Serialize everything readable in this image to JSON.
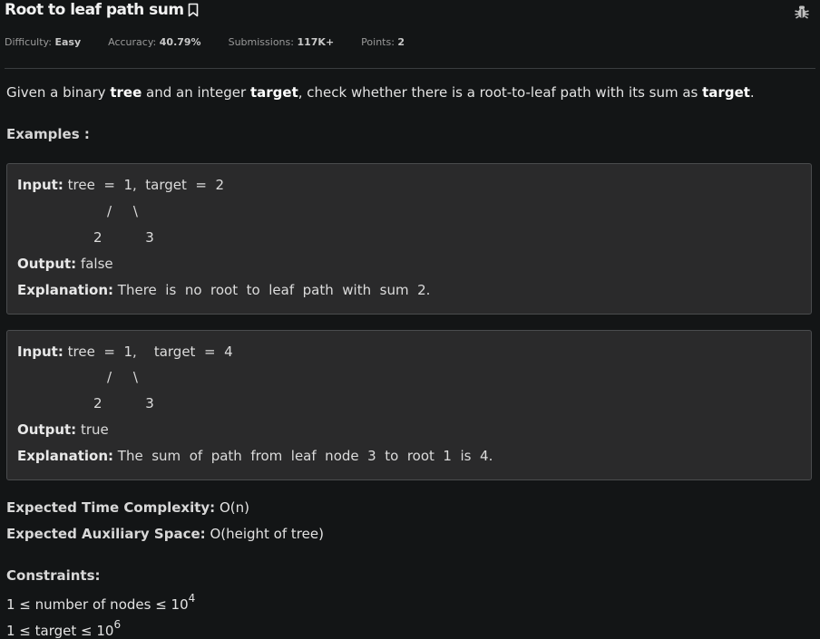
{
  "problem": {
    "title": "Root to leaf path sum",
    "meta": {
      "difficulty_label": "Difficulty:",
      "difficulty": "Easy",
      "accuracy_label": "Accuracy:",
      "accuracy": "40.79%",
      "submissions_label": "Submissions:",
      "submissions": "117K+",
      "points_label": "Points:",
      "points": "2"
    },
    "description": {
      "p1": "Given a binary ",
      "tree": "tree",
      "p2": " and an integer ",
      "target": "target",
      "p3": ", check whether there is a root-to-leaf path with its sum as ",
      "target2": "target",
      "p4": "."
    },
    "examples_heading": "Examples :",
    "examples": [
      {
        "input_label": "Input:",
        "input": " tree  =  1,  target  =  2",
        "tree_line1": "/     \\",
        "tree_line2": "2          3",
        "output_label": "Output:",
        "output": " false",
        "explanation_label": "Explanation:",
        "explanation": " There  is  no  root  to  leaf  path  with  sum  2."
      },
      {
        "input_label": "Input:",
        "input": " tree  =  1,    target  =  4",
        "tree_line1": "/     \\",
        "tree_line2": "2          3",
        "output_label": "Output:",
        "output": " true",
        "explanation_label": "Explanation:",
        "explanation": " The  sum  of  path  from  leaf  node  3  to  root  1  is  4."
      }
    ],
    "complexity": {
      "time_label": "Expected Time Complexity:",
      "time": " O(n)",
      "space_label": "Expected Auxiliary Space:",
      "space": " O(height of tree)"
    },
    "constraints": {
      "heading": "Constraints:",
      "c1_text": "1 ≤ number of nodes ≤ 10",
      "c1_exp": "4",
      "c2_text": "1 ≤ target ≤ 10",
      "c2_exp": "6"
    }
  },
  "icons": {
    "bookmark": "bookmark-icon",
    "bug": "bug-icon"
  }
}
